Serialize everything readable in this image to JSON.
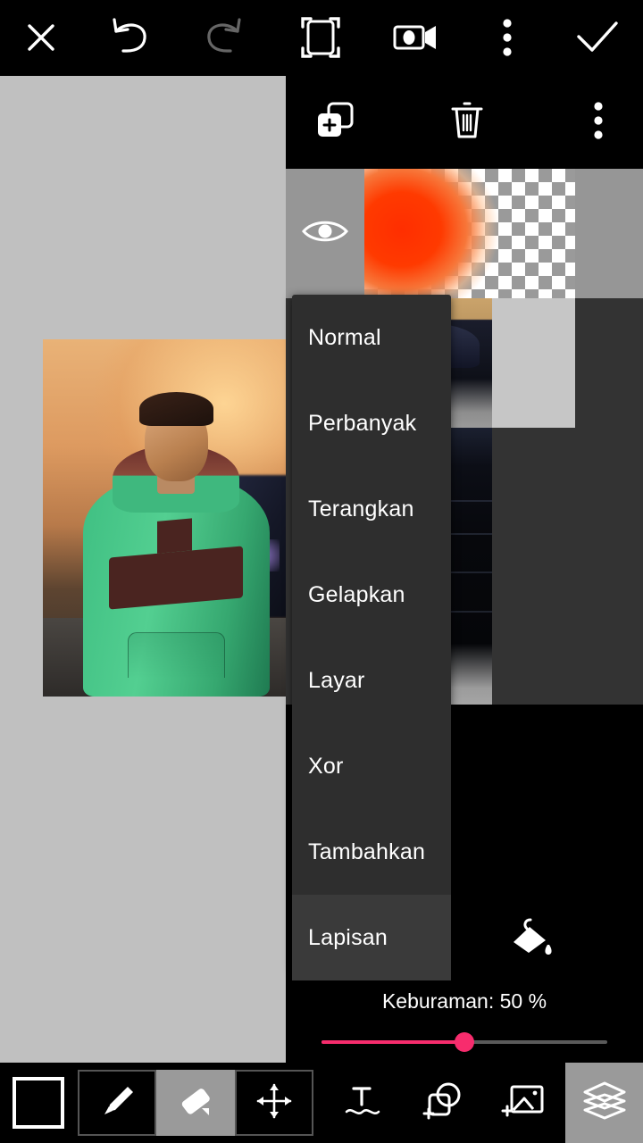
{
  "app": {
    "title": "Photo Editor",
    "accent_pink": "#f72c6d",
    "panel_dark": "#2e2e2e",
    "canvas_bg": "#c0c0c0"
  },
  "topbar": {
    "items": [
      {
        "name": "close-icon",
        "label": "Close"
      },
      {
        "name": "undo-icon",
        "label": "Undo"
      },
      {
        "name": "redo-icon",
        "label": "Redo"
      },
      {
        "name": "crop-icon",
        "label": "Crop"
      },
      {
        "name": "camera-icon",
        "label": "Camera"
      },
      {
        "name": "overflow-menu-icon",
        "label": "More options"
      },
      {
        "name": "confirm-check-icon",
        "label": "Apply"
      }
    ]
  },
  "layer_toolbar": {
    "items": [
      {
        "name": "add-layer-icon",
        "label": "Add layer"
      },
      {
        "name": "delete-layer-icon",
        "label": "Delete layer"
      },
      {
        "name": "layer-overflow-menu-icon",
        "label": "Layer options"
      }
    ]
  },
  "layers": {
    "rows": [
      {
        "name": "layer-row-gradient",
        "visible": true,
        "selected": true,
        "thumb": "orange-gradient-transparent"
      },
      {
        "name": "layer-row-car-portrait",
        "visible": true,
        "selected": false,
        "thumb": "man-and-blue-car"
      },
      {
        "name": "layer-row-dark-car",
        "visible": true,
        "selected": false,
        "thumb": "dark-car-closeup"
      }
    ],
    "eye_icon": "visibility-eye-icon"
  },
  "blend_menu": {
    "open": true,
    "selected": "Lapisan",
    "options": [
      "Normal",
      "Perbanyak",
      "Terangkan",
      "Gelapkan",
      "Layar",
      "Xor",
      "Tambahkan",
      "Lapisan"
    ]
  },
  "opacity": {
    "fill_icon": "paint-bucket-icon",
    "label": "Keburaman:  50 %",
    "value": 50,
    "min": 0,
    "max": 100
  },
  "bottombar": {
    "color_swatch": {
      "name": "color-swatch",
      "color": "#000000"
    },
    "tools": [
      {
        "name": "brush-tool",
        "label": "Brush",
        "active": false
      },
      {
        "name": "eraser-tool",
        "label": "Eraser",
        "active": true
      },
      {
        "name": "move-tool",
        "label": "Move",
        "active": false
      }
    ],
    "actions": [
      {
        "name": "text-tool",
        "label": "Text"
      },
      {
        "name": "add-shape-tool",
        "label": "Add shape"
      },
      {
        "name": "add-image-tool",
        "label": "Add image"
      }
    ],
    "layers_button": {
      "name": "layers-button",
      "label": "Layers",
      "active": true
    }
  }
}
